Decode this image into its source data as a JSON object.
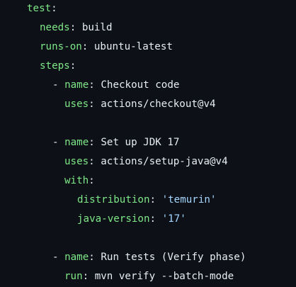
{
  "code": {
    "lines": [
      {
        "key": "test",
        "sep": ":",
        "val": ""
      },
      {
        "key": "needs",
        "sep": ": ",
        "val": "build"
      },
      {
        "key": "runs-on",
        "sep": ": ",
        "val": "ubuntu-latest"
      },
      {
        "key": "steps",
        "sep": ":",
        "val": ""
      },
      {
        "dash": "- ",
        "key": "name",
        "sep": ": ",
        "val": "Checkout code"
      },
      {
        "key": "uses",
        "sep": ": ",
        "val": "actions/checkout@v4"
      },
      {
        "dash": "- ",
        "key": "name",
        "sep": ": ",
        "val": "Set up JDK 17"
      },
      {
        "key": "uses",
        "sep": ": ",
        "val": "actions/setup-java@v4"
      },
      {
        "key": "with",
        "sep": ":",
        "val": ""
      },
      {
        "key": "distribution",
        "sep": ": ",
        "val": "'temurin'"
      },
      {
        "key": "java-version",
        "sep": ": ",
        "val": "'17'"
      },
      {
        "dash": "- ",
        "key": "name",
        "sep": ": ",
        "val": "Run tests (Verify phase)"
      },
      {
        "key": "run",
        "sep": ": ",
        "val": "mvn verify --batch-mode"
      }
    ]
  },
  "colors": {
    "background": "#0d1117",
    "key": "#7ee787",
    "text": "#e6edf3",
    "string": "#a5d6ff"
  }
}
